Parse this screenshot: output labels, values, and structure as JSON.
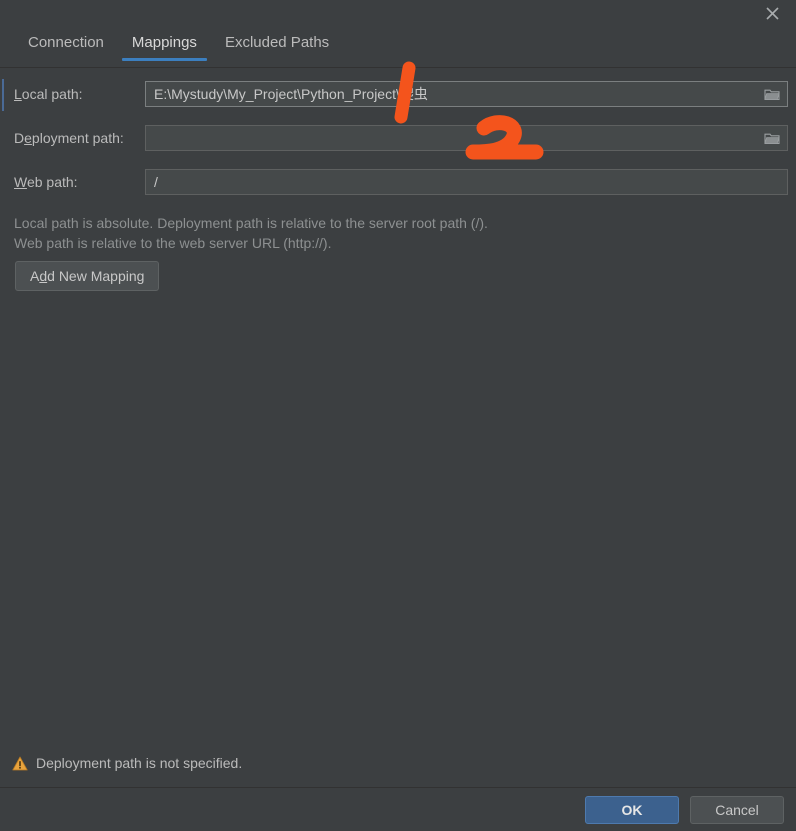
{
  "window": {
    "close_label": "✕"
  },
  "tabs": [
    {
      "label": "Connection",
      "active": false
    },
    {
      "label": "Mappings",
      "active": true
    },
    {
      "label": "Excluded Paths",
      "active": false
    }
  ],
  "form": {
    "local_path": {
      "label_pre": "",
      "label_mnemonic": "L",
      "label_post": "ocal path:",
      "value": "E:\\Mystudy\\My_Project\\Python_Project\\爬虫",
      "browse_icon": "folder-icon"
    },
    "deployment_path": {
      "label_pre": "D",
      "label_mnemonic": "e",
      "label_post": "ployment path:",
      "value": "",
      "browse_icon": "folder-icon"
    },
    "web_path": {
      "label_pre": "",
      "label_mnemonic": "W",
      "label_post": "eb path:",
      "value": "/"
    }
  },
  "hint": {
    "line1": "Local path is absolute. Deployment path is relative to the server root path (/).",
    "line2": "Web path is relative to the web server URL (http://)."
  },
  "add_mapping": {
    "pre": "A",
    "mnemonic": "d",
    "post": "d New Mapping"
  },
  "warning": {
    "icon": "warning-triangle-icon",
    "text": "Deployment path is not specified."
  },
  "buttons": {
    "ok": "OK",
    "cancel": "Cancel"
  },
  "annotations": [
    {
      "name": "annotation-stroke-1",
      "color": "#F4541C"
    },
    {
      "name": "annotation-stroke-2",
      "color": "#F4541C"
    }
  ],
  "colors": {
    "background": "#3C3F41",
    "field_bg": "#45494A",
    "accent_blue": "#3C7FBF",
    "default_button": "#3C618E",
    "annotation_orange": "#F4541C",
    "warning_amber": "#E8A33D"
  }
}
